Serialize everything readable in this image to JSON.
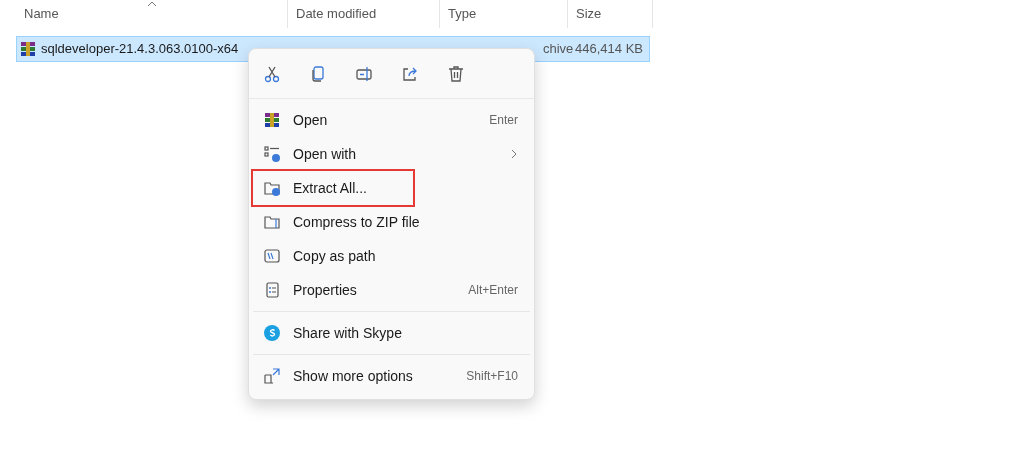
{
  "columns": [
    {
      "label": "Name",
      "sorted": true
    },
    {
      "label": "Date modified",
      "sorted": false
    },
    {
      "label": "Type",
      "sorted": false
    },
    {
      "label": "Size",
      "sorted": false
    }
  ],
  "file_row": {
    "name": "sqldeveloper-21.4.3.063.0100-x64",
    "type_visible": "chive",
    "size": "446,414 KB",
    "selected": true
  },
  "context_menu": {
    "items": [
      {
        "kind": "item",
        "label": "Open",
        "shortcut": "Enter",
        "submenu": false,
        "highlighted": false
      },
      {
        "kind": "item",
        "label": "Open with",
        "submenu": true,
        "highlighted": false
      },
      {
        "kind": "item",
        "label": "Extract All...",
        "submenu": false,
        "highlighted": true
      },
      {
        "kind": "item",
        "label": "Compress to ZIP file",
        "submenu": false,
        "highlighted": false
      },
      {
        "kind": "item",
        "label": "Copy as path",
        "submenu": false,
        "highlighted": false
      },
      {
        "kind": "item",
        "label": "Properties",
        "shortcut": "Alt+Enter",
        "submenu": false,
        "highlighted": false
      },
      {
        "kind": "separator"
      },
      {
        "kind": "item",
        "label": "Share with Skype",
        "submenu": false,
        "highlighted": false
      },
      {
        "kind": "separator"
      },
      {
        "kind": "item",
        "label": "Show more options",
        "shortcut": "Shift+F10",
        "submenu": false,
        "highlighted": false
      }
    ]
  }
}
